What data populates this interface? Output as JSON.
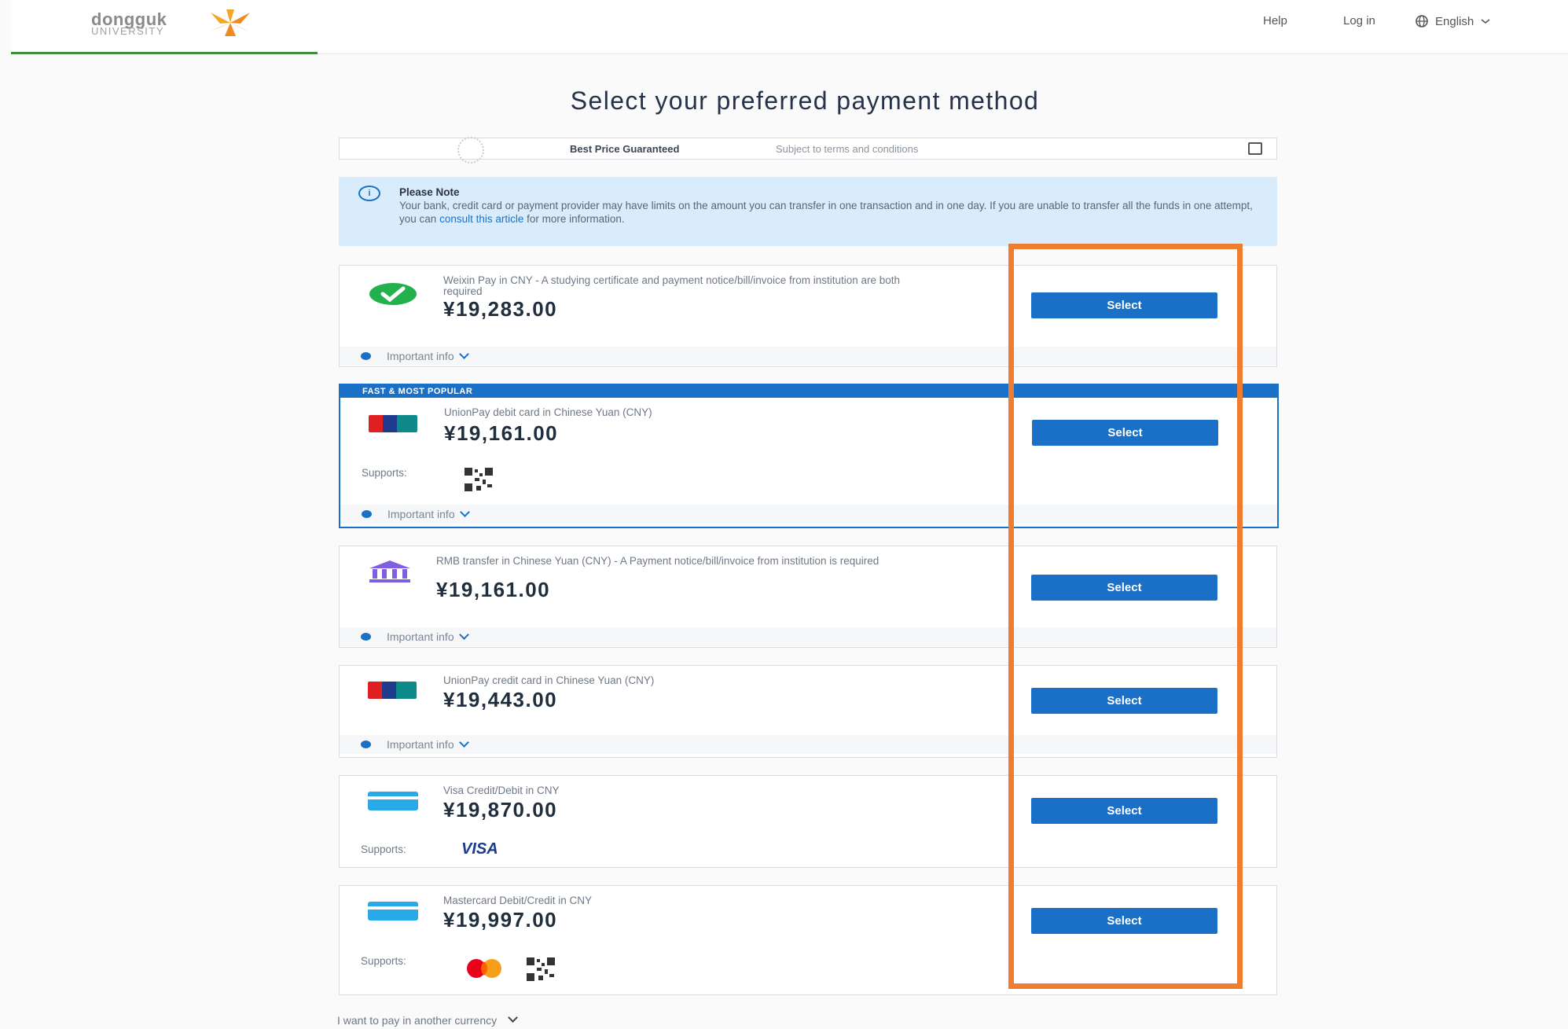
{
  "header": {
    "logo_main": "dongguk",
    "logo_sub": "UNIVERSITY",
    "help": "Help",
    "login": "Log in",
    "language": "English"
  },
  "page_title": "Select your preferred payment method",
  "best_price": {
    "strong": "Best Price Guaranteed",
    "text": "Subject to terms and conditions"
  },
  "note": {
    "title": "Please Note",
    "body": "Your bank, credit card or payment provider may have limits on the amount you can transfer in one transaction and in one day. If you are unable to transfer all the funds in one attempt, you can",
    "link": "consult this article",
    "tail": "for more information."
  },
  "featured_label": "FAST & MOST POPULAR",
  "select_label": "Select",
  "important_info": "Important info",
  "supports_label": "Supports:",
  "methods": [
    {
      "desc": "Weixin Pay in CNY - A studying certificate and payment notice/bill/invoice from institution are both required",
      "price": "¥19,283.00",
      "icon": "wechat-pay-icon"
    },
    {
      "desc": "UnionPay debit card in Chinese Yuan (CNY)",
      "price": "¥19,161.00",
      "icon": "unionpay-icon"
    },
    {
      "desc": "RMB transfer in Chinese Yuan (CNY) - A Payment notice/bill/invoice from institution is required",
      "price": "¥19,161.00",
      "icon": "bank-icon"
    },
    {
      "desc": "UnionPay credit card in Chinese Yuan (CNY)",
      "price": "¥19,443.00",
      "icon": "unionpay-icon"
    },
    {
      "desc": "Visa Credit/Debit in CNY",
      "price": "¥19,870.00",
      "icon": "credit-card-icon",
      "supports": "VISA"
    },
    {
      "desc": "Mastercard Debit/Credit in CNY",
      "price": "¥19,997.00",
      "icon": "credit-card-icon"
    }
  ],
  "other_currency": "I want to pay in another currency",
  "colors": {
    "primary": "#1a6fc7",
    "highlight": "#ee7d30",
    "note_bg": "#d9ecfb",
    "accent_green": "#3f8f3a"
  }
}
